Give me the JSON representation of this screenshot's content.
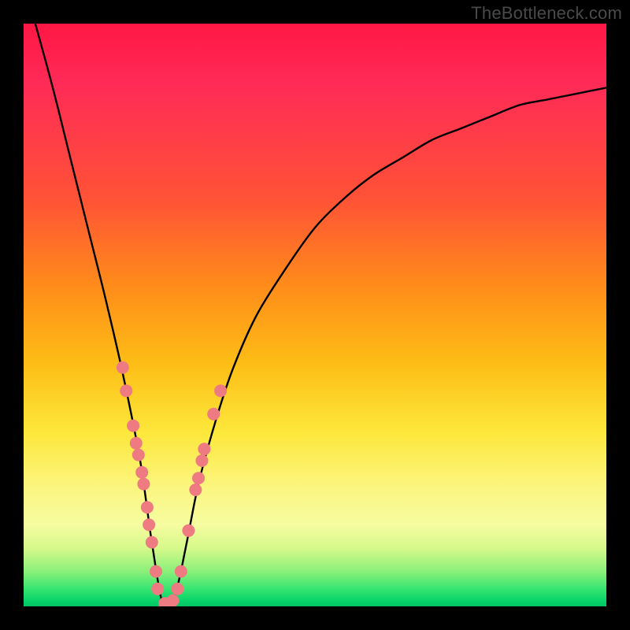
{
  "watermark": "TheBottleneck.com",
  "colors": {
    "frame": "#000000",
    "watermark": "#4a4a4a",
    "curve": "#000000",
    "dots": "#ee7b81",
    "gradient_stops": [
      "#ff1744",
      "#ff2a57",
      "#ff5236",
      "#ff8c1a",
      "#fdbc15",
      "#fde73a",
      "#fbf682",
      "#f6fca0",
      "#d6f98a",
      "#8af07a",
      "#36e571",
      "#09d46a",
      "#00c463"
    ]
  },
  "chart_data": {
    "type": "line",
    "title": "",
    "xlabel": "",
    "ylabel": "",
    "xlim": [
      0,
      100
    ],
    "ylim": [
      0,
      100
    ],
    "note": "V-shaped bottleneck curve over red-to-green heatmap background. Axes are unlabeled. Curve y-values estimated from the plot (0 = bottom/green, 100 = top/red). Minimum near x≈24.",
    "series": [
      {
        "name": "bottleneck-curve",
        "x": [
          2,
          5,
          8,
          11,
          14,
          17,
          20,
          22,
          24,
          26,
          28,
          30,
          33,
          36,
          40,
          45,
          50,
          55,
          60,
          65,
          70,
          75,
          80,
          85,
          90,
          95,
          100
        ],
        "y": [
          100,
          89,
          77,
          65,
          53,
          40,
          25,
          11,
          0,
          2,
          11,
          21,
          32,
          41,
          50,
          58,
          65,
          70,
          74,
          77,
          80,
          82,
          84,
          86,
          87,
          88,
          89
        ]
      }
    ],
    "scatter_points": {
      "name": "highlight-dots",
      "note": "Pink dots clustered along both arms of the V near the bottom.",
      "points": [
        {
          "x": 17.0,
          "y": 41
        },
        {
          "x": 17.6,
          "y": 37
        },
        {
          "x": 18.8,
          "y": 31
        },
        {
          "x": 19.3,
          "y": 28
        },
        {
          "x": 19.7,
          "y": 26
        },
        {
          "x": 20.3,
          "y": 23
        },
        {
          "x": 20.6,
          "y": 21
        },
        {
          "x": 21.2,
          "y": 17
        },
        {
          "x": 21.5,
          "y": 14
        },
        {
          "x": 22.0,
          "y": 11
        },
        {
          "x": 22.7,
          "y": 6
        },
        {
          "x": 23.0,
          "y": 3
        },
        {
          "x": 24.2,
          "y": 0.5
        },
        {
          "x": 25.6,
          "y": 1
        },
        {
          "x": 26.4,
          "y": 3
        },
        {
          "x": 27.0,
          "y": 6
        },
        {
          "x": 28.3,
          "y": 13
        },
        {
          "x": 29.5,
          "y": 20
        },
        {
          "x": 30.0,
          "y": 22
        },
        {
          "x": 30.6,
          "y": 25
        },
        {
          "x": 31.0,
          "y": 27
        },
        {
          "x": 32.6,
          "y": 33
        },
        {
          "x": 33.8,
          "y": 37
        }
      ]
    }
  }
}
